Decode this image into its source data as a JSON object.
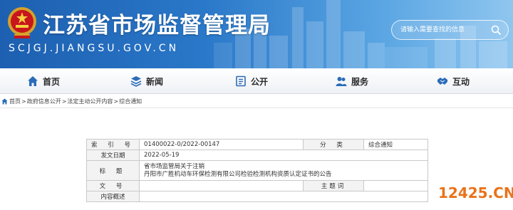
{
  "header": {
    "site_title": "江苏省市场监督管理局",
    "site_url": "SCJGJ.JIANGSU.GOV.CN",
    "search": {
      "placeholder": "请输入需要查找的信息"
    }
  },
  "nav": {
    "items": [
      {
        "label": "首页",
        "icon": "home-icon"
      },
      {
        "label": "新闻",
        "icon": "layers-icon"
      },
      {
        "label": "公开",
        "icon": "document-icon"
      },
      {
        "label": "服务",
        "icon": "people-icon"
      },
      {
        "label": "互动",
        "icon": "handshake-icon"
      }
    ]
  },
  "breadcrumb": {
    "items": [
      "首页",
      "政府信息公开",
      "法定主动公开内容",
      "综合通知"
    ],
    "separator": ">"
  },
  "info_table": {
    "index_label": "索 引 号",
    "index_value": "01400022-0/2022-00147",
    "category_label": "分 类",
    "category_value": "综合通知",
    "date_label": "发文日期",
    "date_value": "2022-05-19",
    "title_label": "标 题",
    "title_line1": "省市场监管局关于注销",
    "title_line2": "丹阳市广胜机动车环保检测有限公司检验检测机构资质认定证书的公告",
    "doc_no_label": "文 号",
    "doc_no_value": "",
    "keywords_label": "主题词",
    "keywords_value": "",
    "summary_label": "内容概述",
    "summary_value": ""
  },
  "watermark": "12425.CN",
  "colors": {
    "banner_dark": "#1d5fb0",
    "banner_light": "#8fc6ef",
    "watermark": "#e8731a",
    "nav_icon": "#2b6cb8"
  }
}
